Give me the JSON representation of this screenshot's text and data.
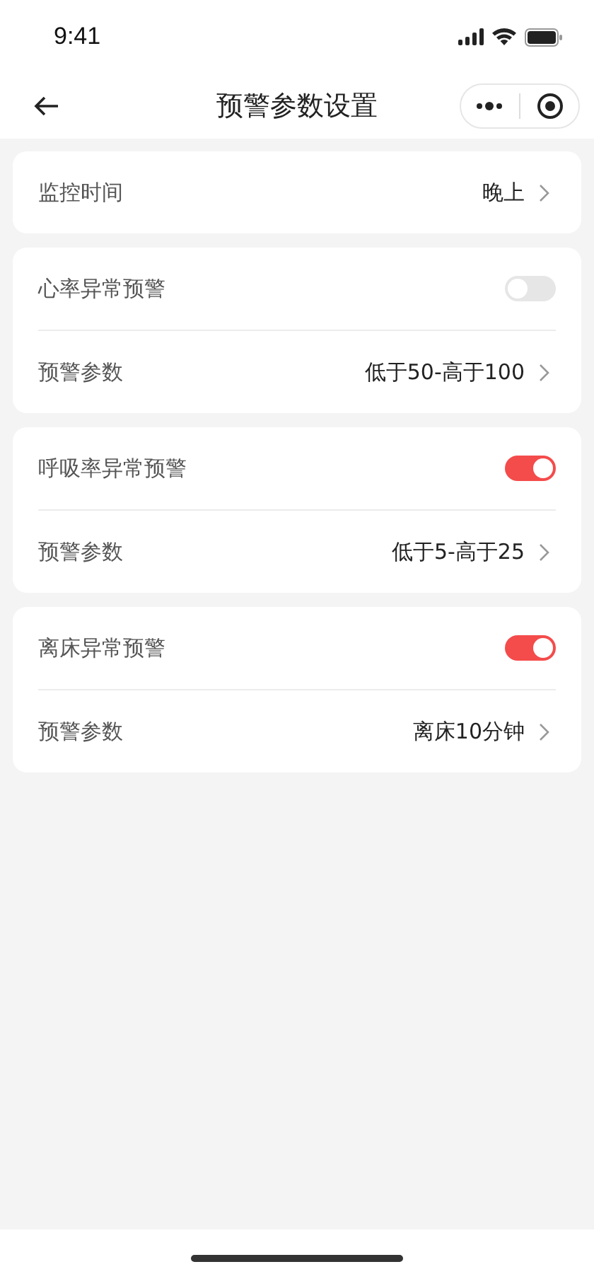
{
  "status_bar": {
    "time": "9:41"
  },
  "nav": {
    "title": "预警参数设置"
  },
  "sections": [
    {
      "rows": [
        {
          "kind": "link",
          "label": "监控时间",
          "value": "晚上"
        }
      ]
    },
    {
      "rows": [
        {
          "kind": "toggle",
          "label": "心率异常预警",
          "on": false
        },
        {
          "kind": "link",
          "label": "预警参数",
          "value": "低于50-高于100"
        }
      ]
    },
    {
      "rows": [
        {
          "kind": "toggle",
          "label": "呼吸率异常预警",
          "on": true
        },
        {
          "kind": "link",
          "label": "预警参数",
          "value": "低于5-高于25"
        }
      ]
    },
    {
      "rows": [
        {
          "kind": "toggle",
          "label": "离床异常预警",
          "on": true
        },
        {
          "kind": "link",
          "label": "预警参数",
          "value": "离床10分钟"
        }
      ]
    }
  ]
}
